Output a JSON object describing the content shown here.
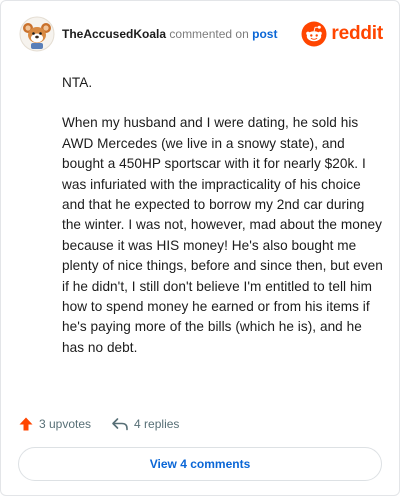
{
  "header": {
    "username": "TheAccusedKoala",
    "action_text": "commented on",
    "target_link": "post",
    "brand_name": "reddit",
    "brand_color": "#ff4500"
  },
  "comment": {
    "paragraphs": [
      "NTA.",
      "When my husband and I were dating, he sold his AWD Mercedes (we live in a snowy state), and bought a 450HP sportscar with it for nearly $20k. I was infuriated with the impracticality of his choice and that he expected to borrow my 2nd car during the winter. I was not, however, mad about the money because it was HIS money! He's also bought me plenty of nice things, before and since then, but even if he didn't, I still don't believe I'm entitled to tell him how to spend money he earned or from his items if he's paying more of the bills (which he is), and he has no debt."
    ]
  },
  "actions": {
    "upvotes_label": "3 upvotes",
    "replies_label": "4 replies"
  },
  "footer": {
    "view_comments_label": "View 4 comments"
  },
  "icons": {
    "avatar": "koala-avatar-icon",
    "brand": "reddit-snoo-icon",
    "upvote": "upvote-arrow-icon",
    "reply": "reply-arrow-icon"
  },
  "colors": {
    "link": "#0a66d6",
    "upvote": "#ff4500",
    "muted": "#576f76"
  }
}
